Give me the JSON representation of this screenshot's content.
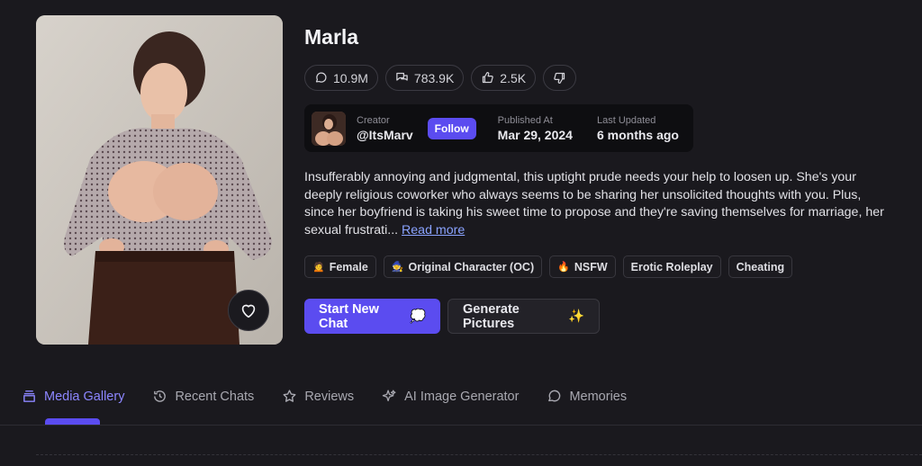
{
  "character": {
    "name": "Marla",
    "stats": {
      "messages": "10.9M",
      "chats": "783.9K",
      "likes": "2.5K"
    },
    "creator_label": "Creator",
    "creator_name": "@ItsMarv",
    "follow_label": "Follow",
    "published_label": "Published At",
    "published_value": "Mar 29, 2024",
    "updated_label": "Last Updated",
    "updated_value": "6 months ago",
    "description": "Insufferably annoying and judgmental, this uptight prude needs your help to loosen up. She's your deeply religious coworker who always seems to be sharing her unsolicited thoughts with you. Plus, since her boyfriend is taking his sweet time to propose and they're saving themselves for marriage, her sexual frustrati...",
    "read_more": "Read more",
    "tags": [
      {
        "emoji": "🙍",
        "label": "Female"
      },
      {
        "emoji": "🧙",
        "label": "Original Character (OC)"
      },
      {
        "emoji": "🔥",
        "label": "NSFW"
      },
      {
        "emoji": "",
        "label": "Erotic Roleplay"
      },
      {
        "emoji": "",
        "label": "Cheating"
      }
    ],
    "start_chat": "Start New Chat",
    "start_chat_emoji": "💭",
    "generate": "Generate Pictures",
    "generate_emoji": "✨"
  },
  "tabs": [
    {
      "label": "Media Gallery",
      "icon": "stack-icon",
      "active": true
    },
    {
      "label": "Recent Chats",
      "icon": "history-icon",
      "active": false
    },
    {
      "label": "Reviews",
      "icon": "star-icon",
      "active": false
    },
    {
      "label": "AI Image Generator",
      "icon": "sparkles-icon",
      "active": false
    },
    {
      "label": "Memories",
      "icon": "chat-bubble-icon",
      "active": false
    }
  ],
  "colors": {
    "accent": "#5b4cf0",
    "background": "#1a191e",
    "link": "#8aa3ff"
  }
}
